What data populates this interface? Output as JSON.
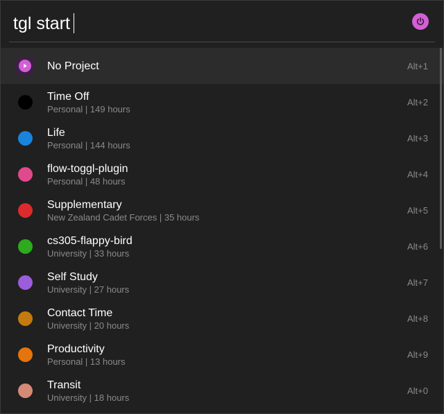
{
  "search": {
    "query": "tgl start"
  },
  "plugin": {
    "icon": "power-icon",
    "color": "#d35fd5"
  },
  "results": [
    {
      "title": "No Project",
      "subtitle": "",
      "hotkey": "Alt+1",
      "icon": "play-icon",
      "color": "#d35fd5",
      "selected": true
    },
    {
      "title": "Time Off",
      "subtitle": "Personal | 149 hours",
      "hotkey": "Alt+2",
      "color": "#000000"
    },
    {
      "title": "Life",
      "subtitle": "Personal | 144 hours",
      "hotkey": "Alt+3",
      "color": "#1a83dc"
    },
    {
      "title": "flow-toggl-plugin",
      "subtitle": "Personal | 48 hours",
      "hotkey": "Alt+4",
      "color": "#df4a8c"
    },
    {
      "title": "Supplementary",
      "subtitle": "New Zealand Cadet Forces | 35 hours",
      "hotkey": "Alt+5",
      "color": "#dc2b2e"
    },
    {
      "title": "cs305-flappy-bird",
      "subtitle": "University | 33 hours",
      "hotkey": "Alt+6",
      "color": "#2daa1e"
    },
    {
      "title": "Self Study",
      "subtitle": "University | 27 hours",
      "hotkey": "Alt+7",
      "color": "#9c5ddb"
    },
    {
      "title": "Contact Time",
      "subtitle": "University | 20 hours",
      "hotkey": "Alt+8",
      "color": "#c47a0e"
    },
    {
      "title": "Productivity",
      "subtitle": "Personal | 13 hours",
      "hotkey": "Alt+9",
      "color": "#e5740c"
    },
    {
      "title": "Transit",
      "subtitle": "University | 18 hours",
      "hotkey": "Alt+0",
      "color": "#d48a75"
    }
  ]
}
